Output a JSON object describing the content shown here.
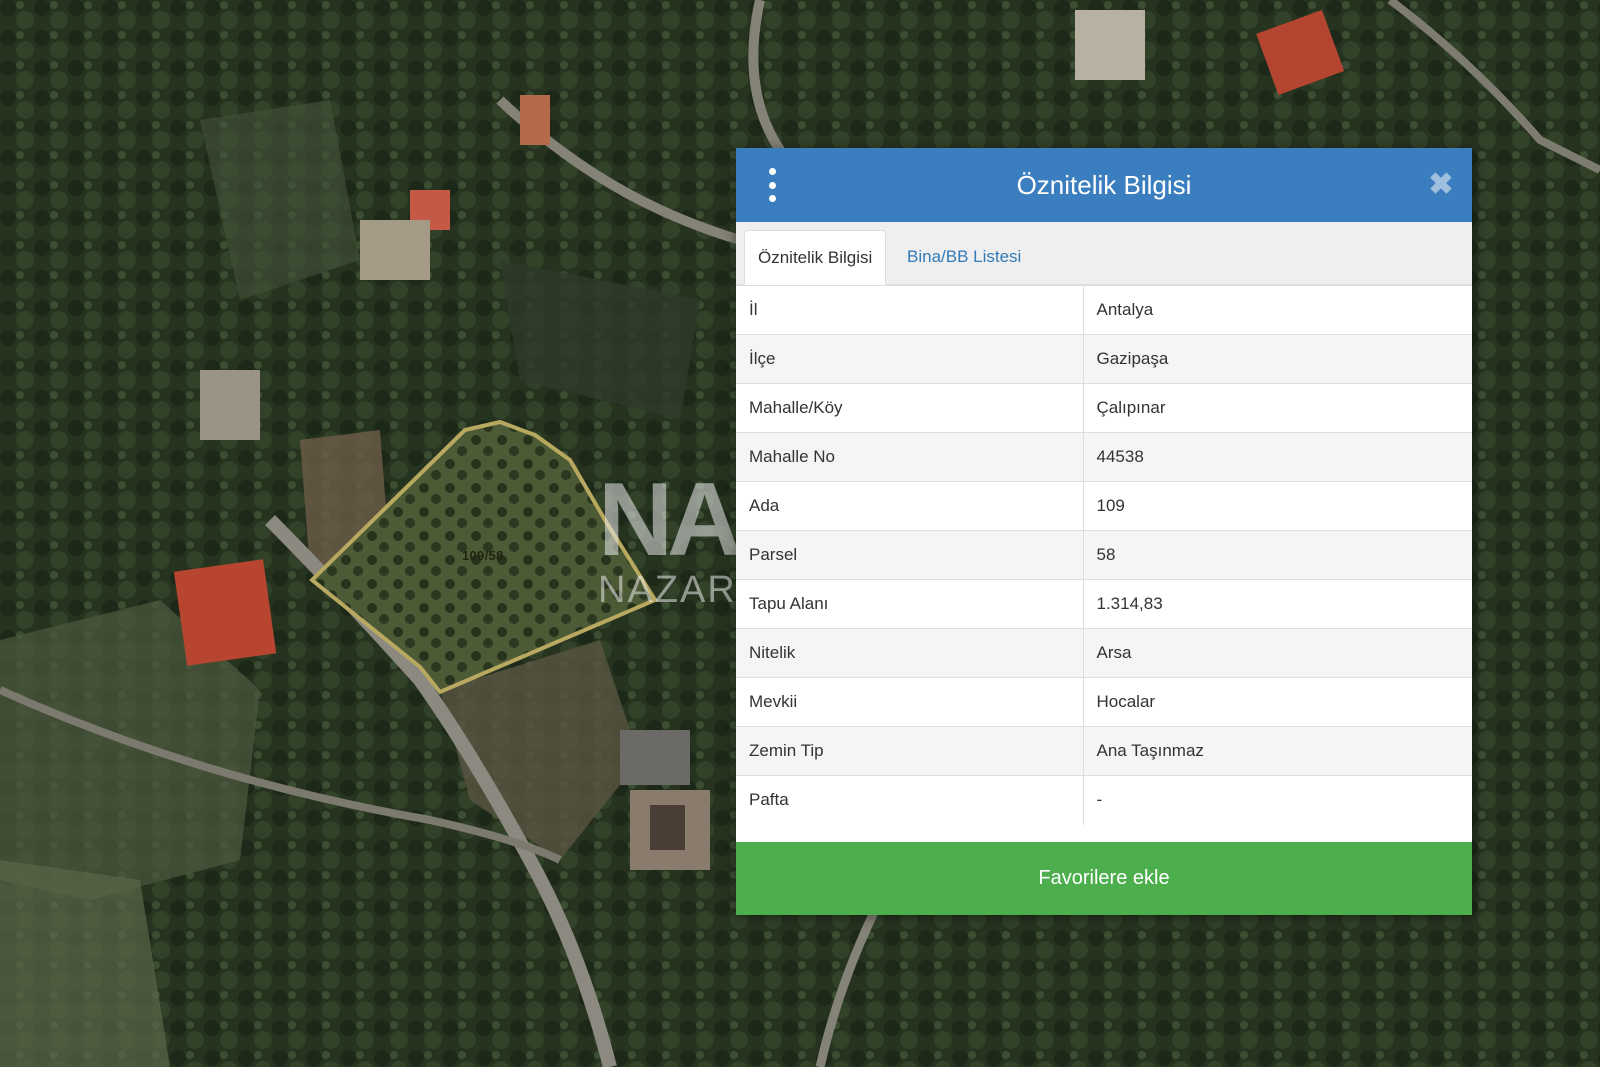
{
  "map": {
    "parcel_label": "109/58",
    "watermark_logo": "NAZAR",
    "watermark_text": "NAZAR"
  },
  "panel": {
    "title": "Öznitelik Bilgisi",
    "menu_icon": "vertical-ellipsis-icon",
    "close_icon": "close-icon",
    "close_glyph": "✖",
    "tabs": [
      {
        "label": "Öznitelik Bilgisi",
        "active": true
      },
      {
        "label": "Bina/BB Listesi",
        "active": false
      }
    ],
    "rows": [
      {
        "key": "İl",
        "value": "Antalya"
      },
      {
        "key": "İlçe",
        "value": "Gazipaşa"
      },
      {
        "key": "Mahalle/Köy",
        "value": "Çalıpınar"
      },
      {
        "key": "Mahalle No",
        "value": "44538"
      },
      {
        "key": "Ada",
        "value": "109"
      },
      {
        "key": "Parsel",
        "value": "58"
      },
      {
        "key": "Tapu Alanı",
        "value": "1.314,83"
      },
      {
        "key": "Nitelik",
        "value": "Arsa"
      },
      {
        "key": "Mevkii",
        "value": "Hocalar"
      },
      {
        "key": "Zemin Tip",
        "value": "Ana Taşınmaz"
      },
      {
        "key": "Pafta",
        "value": "-"
      }
    ],
    "favorite_button": "Favorilere ekle"
  },
  "colors": {
    "header": "#3a7ebf",
    "tab_link": "#337ab7",
    "favorite_button": "#4cae4c",
    "parcel_outline": "#b8a860"
  }
}
